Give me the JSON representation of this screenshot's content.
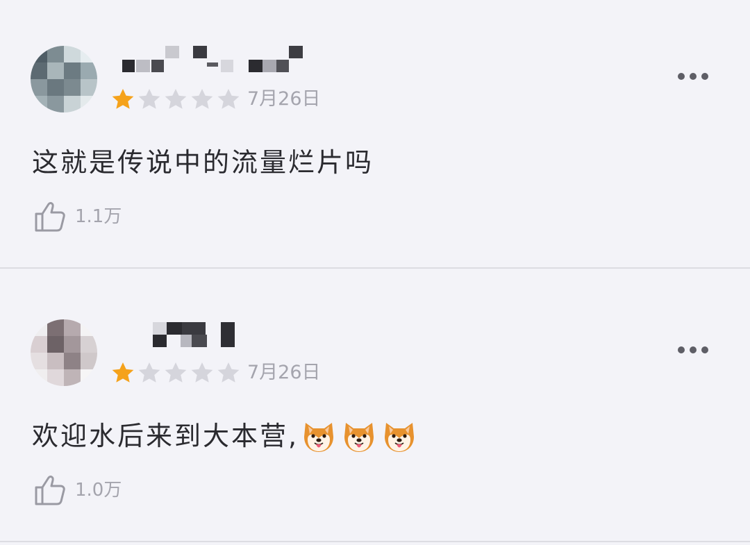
{
  "comments": [
    {
      "username": "",
      "rating": 1,
      "rating_max": 5,
      "date": "7月26日",
      "text": "这就是传说中的流量烂片吗",
      "emoji": [],
      "likes": "1.1万"
    },
    {
      "username": "",
      "rating": 1,
      "rating_max": 5,
      "date": "7月26日",
      "text": "欢迎水后来到大本营,",
      "emoji": [
        "dog-face-emoji",
        "dog-face-emoji",
        "dog-face-emoji"
      ],
      "likes": "1.0万"
    }
  ],
  "colors": {
    "background": "#f3f3f8",
    "star_filled": "#f5a21b",
    "star_empty": "#d5d5dc",
    "secondary_text": "#a4a4ad",
    "primary_text": "#2a2a2f",
    "divider": "#dcdce2"
  },
  "icons": {
    "more": "more-dots-icon",
    "like": "thumbs-up-icon",
    "star": "star-icon"
  }
}
